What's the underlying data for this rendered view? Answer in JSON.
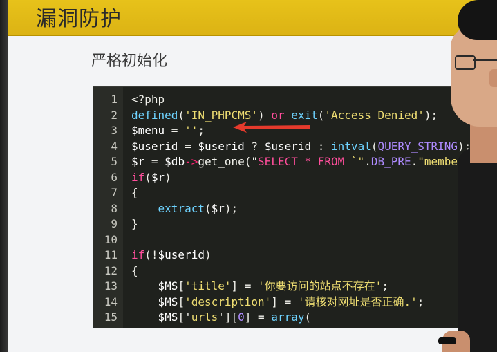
{
  "slide": {
    "title": "漏洞防护",
    "subtitle": "严格初始化"
  },
  "colors": {
    "title_bar": "#e0b818",
    "code_bg": "#1f211d",
    "keyword": "#ff4e9b",
    "function": "#6ed3ff",
    "string": "#eedd72",
    "constant": "#ae8bff",
    "arrow": "#e53a2c"
  },
  "code": {
    "lines": [
      {
        "n": "1",
        "tokens": [
          {
            "t": "<?php",
            "c": "tx"
          }
        ]
      },
      {
        "n": "2",
        "tokens": [
          {
            "t": "defined",
            "c": "fn"
          },
          {
            "t": "(",
            "c": "tx"
          },
          {
            "t": "'IN_PHPCMS'",
            "c": "st"
          },
          {
            "t": ") ",
            "c": "tx"
          },
          {
            "t": "or",
            "c": "kw"
          },
          {
            "t": " ",
            "c": "tx"
          },
          {
            "t": "exit",
            "c": "fn"
          },
          {
            "t": "(",
            "c": "tx"
          },
          {
            "t": "'Access Denied'",
            "c": "st"
          },
          {
            "t": ");",
            "c": "tx"
          }
        ]
      },
      {
        "n": "3",
        "tokens": [
          {
            "t": "$menu",
            "c": "vr"
          },
          {
            "t": " = ",
            "c": "tx"
          },
          {
            "t": "''",
            "c": "st"
          },
          {
            "t": ";",
            "c": "tx"
          }
        ]
      },
      {
        "n": "4",
        "tokens": [
          {
            "t": "$userid",
            "c": "vr"
          },
          {
            "t": " = ",
            "c": "tx"
          },
          {
            "t": "$userid",
            "c": "vr"
          },
          {
            "t": " ? ",
            "c": "tx"
          },
          {
            "t": "$userid",
            "c": "vr"
          },
          {
            "t": " : ",
            "c": "tx"
          },
          {
            "t": "intval",
            "c": "fn"
          },
          {
            "t": "(",
            "c": "tx"
          },
          {
            "t": "QUERY_STRING",
            "c": "cn"
          },
          {
            "t": ");",
            "c": "tx"
          }
        ]
      },
      {
        "n": "5",
        "tokens": [
          {
            "t": "$r",
            "c": "vr"
          },
          {
            "t": " = ",
            "c": "tx"
          },
          {
            "t": "$db",
            "c": "vr"
          },
          {
            "t": "->",
            "c": "op"
          },
          {
            "t": "get_one",
            "c": "tx"
          },
          {
            "t": "(\"",
            "c": "tx"
          },
          {
            "t": "SELECT * FROM",
            "c": "kw"
          },
          {
            "t": " `\"",
            "c": "st"
          },
          {
            "t": ".",
            "c": "tx"
          },
          {
            "t": "DB_PRE",
            "c": "cn"
          },
          {
            "t": ".",
            "c": "tx"
          },
          {
            "t": "\"member",
            "c": "st"
          }
        ]
      },
      {
        "n": "6",
        "tokens": [
          {
            "t": "if",
            "c": "kw"
          },
          {
            "t": "(",
            "c": "tx"
          },
          {
            "t": "$r",
            "c": "vr"
          },
          {
            "t": ")",
            "c": "tx"
          }
        ]
      },
      {
        "n": "7",
        "tokens": [
          {
            "t": "{",
            "c": "tx"
          }
        ]
      },
      {
        "n": "8",
        "tokens": [
          {
            "t": "    ",
            "c": "tx"
          },
          {
            "t": "extract",
            "c": "fn"
          },
          {
            "t": "(",
            "c": "tx"
          },
          {
            "t": "$r",
            "c": "vr"
          },
          {
            "t": ");",
            "c": "tx"
          }
        ]
      },
      {
        "n": "9",
        "tokens": [
          {
            "t": "}",
            "c": "tx"
          }
        ]
      },
      {
        "n": "10",
        "tokens": []
      },
      {
        "n": "11",
        "tokens": [
          {
            "t": "if",
            "c": "kw"
          },
          {
            "t": "(!",
            "c": "tx"
          },
          {
            "t": "$userid",
            "c": "vr"
          },
          {
            "t": ")",
            "c": "tx"
          }
        ]
      },
      {
        "n": "12",
        "tokens": [
          {
            "t": "{",
            "c": "tx"
          }
        ]
      },
      {
        "n": "13",
        "tokens": [
          {
            "t": "    ",
            "c": "tx"
          },
          {
            "t": "$MS",
            "c": "vr"
          },
          {
            "t": "[",
            "c": "tx"
          },
          {
            "t": "'title'",
            "c": "st"
          },
          {
            "t": "] = ",
            "c": "tx"
          },
          {
            "t": "'你要访问的站点不存在'",
            "c": "st"
          },
          {
            "t": ";",
            "c": "tx"
          }
        ]
      },
      {
        "n": "14",
        "tokens": [
          {
            "t": "    ",
            "c": "tx"
          },
          {
            "t": "$MS",
            "c": "vr"
          },
          {
            "t": "[",
            "c": "tx"
          },
          {
            "t": "'description'",
            "c": "st"
          },
          {
            "t": "] = ",
            "c": "tx"
          },
          {
            "t": "'请核对网址是否正确.'",
            "c": "st"
          },
          {
            "t": ";",
            "c": "tx"
          }
        ]
      },
      {
        "n": "15",
        "tokens": [
          {
            "t": "    ",
            "c": "tx"
          },
          {
            "t": "$MS",
            "c": "vr"
          },
          {
            "t": "['",
            "c": "tx"
          },
          {
            "t": "urls",
            "c": "st"
          },
          {
            "t": "'][",
            "c": "tx"
          },
          {
            "t": "0",
            "c": "cn"
          },
          {
            "t": "] = ",
            "c": "tx"
          },
          {
            "t": "array",
            "c": "fn"
          },
          {
            "t": "(",
            "c": "tx"
          }
        ]
      }
    ]
  }
}
